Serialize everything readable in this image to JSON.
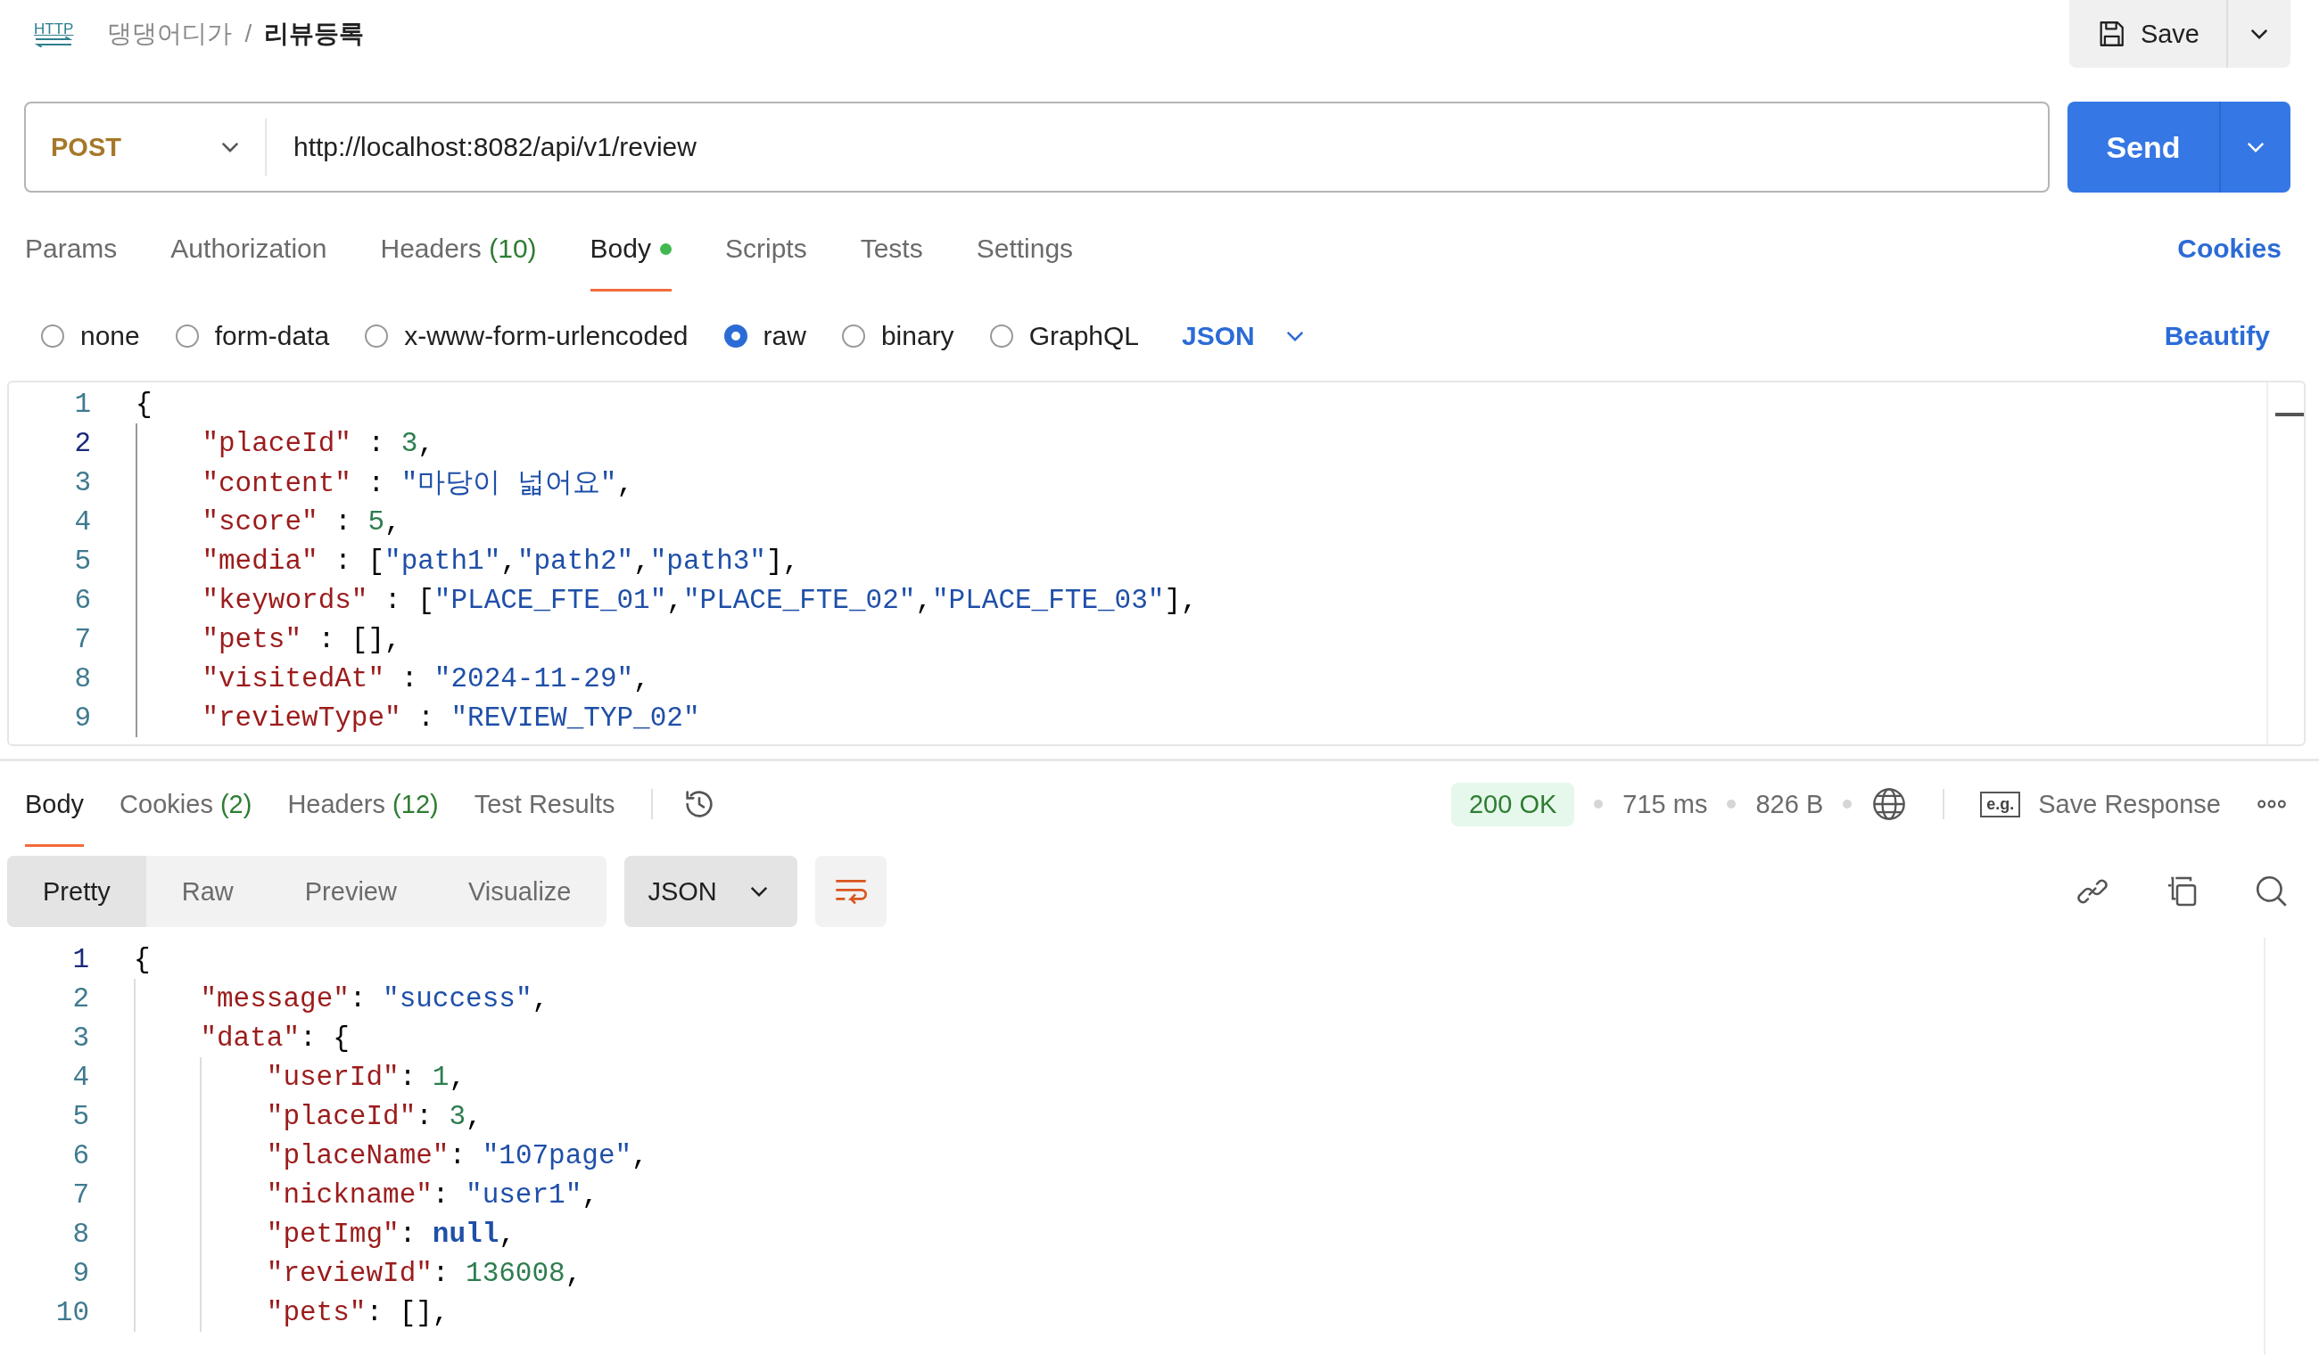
{
  "header": {
    "request_type": "HTTP",
    "breadcrumb_separator": "/",
    "breadcrumb": [
      {
        "label": "댕댕어디가",
        "current": false
      },
      {
        "label": "리뷰등록",
        "current": true
      }
    ],
    "save_label": "Save"
  },
  "request": {
    "method": "POST",
    "url": "http://localhost:8082/api/v1/review",
    "send_label": "Send"
  },
  "request_tabs": [
    {
      "label": "Params",
      "selected": false,
      "has_content": false
    },
    {
      "label": "Authorization",
      "selected": false,
      "has_content": false
    },
    {
      "label": "Headers",
      "count": "(10)",
      "selected": false,
      "has_content": false
    },
    {
      "label": "Body",
      "selected": true,
      "has_content": true
    },
    {
      "label": "Scripts",
      "selected": false,
      "has_content": false
    },
    {
      "label": "Tests",
      "selected": false,
      "has_content": false
    },
    {
      "label": "Settings",
      "selected": false,
      "has_content": false
    }
  ],
  "cookies_link": "Cookies",
  "body_types": [
    {
      "label": "none",
      "selected": false
    },
    {
      "label": "form-data",
      "selected": false
    },
    {
      "label": "x-www-form-urlencoded",
      "selected": false
    },
    {
      "label": "raw",
      "selected": true
    },
    {
      "label": "binary",
      "selected": false
    },
    {
      "label": "GraphQL",
      "selected": false
    }
  ],
  "body_format": "JSON",
  "beautify_label": "Beautify",
  "request_body": [
    {
      "number": "1",
      "current": false,
      "tokens": [
        {
          "kind": "punct",
          "text": "{"
        }
      ],
      "children": [
        {
          "number": "2",
          "current": true,
          "tokens": [
            {
              "kind": "key",
              "text": "\"placeId\""
            },
            {
              "kind": "punct",
              "text": " : "
            },
            {
              "kind": "num",
              "text": "3"
            },
            {
              "kind": "punct",
              "text": ","
            }
          ]
        },
        {
          "number": "3",
          "current": false,
          "tokens": [
            {
              "kind": "key",
              "text": "\"content\""
            },
            {
              "kind": "punct",
              "text": " : "
            },
            {
              "kind": "str",
              "text": "\"마당이 넓어요\""
            },
            {
              "kind": "punct",
              "text": ","
            }
          ]
        },
        {
          "number": "4",
          "current": false,
          "tokens": [
            {
              "kind": "key",
              "text": "\"score\""
            },
            {
              "kind": "punct",
              "text": " : "
            },
            {
              "kind": "num",
              "text": "5"
            },
            {
              "kind": "punct",
              "text": ","
            }
          ]
        },
        {
          "number": "5",
          "current": false,
          "tokens": [
            {
              "kind": "key",
              "text": "\"media\""
            },
            {
              "kind": "punct",
              "text": " : ["
            },
            {
              "kind": "str",
              "text": "\"path1\""
            },
            {
              "kind": "punct",
              "text": ","
            },
            {
              "kind": "str",
              "text": "\"path2\""
            },
            {
              "kind": "punct",
              "text": ","
            },
            {
              "kind": "str",
              "text": "\"path3\""
            },
            {
              "kind": "punct",
              "text": "],"
            }
          ]
        },
        {
          "number": "6",
          "current": false,
          "tokens": [
            {
              "kind": "key",
              "text": "\"keywords\""
            },
            {
              "kind": "punct",
              "text": " : ["
            },
            {
              "kind": "str",
              "text": "\"PLACE_FTE_01\""
            },
            {
              "kind": "punct",
              "text": ","
            },
            {
              "kind": "str",
              "text": "\"PLACE_FTE_02\""
            },
            {
              "kind": "punct",
              "text": ","
            },
            {
              "kind": "str",
              "text": "\"PLACE_FTE_03\""
            },
            {
              "kind": "punct",
              "text": "],"
            }
          ]
        },
        {
          "number": "7",
          "current": false,
          "tokens": [
            {
              "kind": "key",
              "text": "\"pets\""
            },
            {
              "kind": "punct",
              "text": " : [],"
            }
          ]
        },
        {
          "number": "8",
          "current": false,
          "tokens": [
            {
              "kind": "key",
              "text": "\"visitedAt\""
            },
            {
              "kind": "punct",
              "text": " : "
            },
            {
              "kind": "str",
              "text": "\"2024-11-29\""
            },
            {
              "kind": "punct",
              "text": ","
            }
          ]
        },
        {
          "number": "9",
          "current": false,
          "tokens": [
            {
              "kind": "key",
              "text": "\"reviewType\""
            },
            {
              "kind": "punct",
              "text": " : "
            },
            {
              "kind": "str",
              "text": "\"REVIEW_TYP_02\""
            }
          ]
        }
      ]
    }
  ],
  "response_tabs": [
    {
      "label": "Body",
      "selected": true
    },
    {
      "label": "Cookies",
      "count": "(2)",
      "selected": false
    },
    {
      "label": "Headers",
      "count": "(12)",
      "selected": false
    },
    {
      "label": "Test Results",
      "selected": false
    }
  ],
  "response_meta": {
    "status": "200 OK",
    "time": "715 ms",
    "size": "826 B",
    "example_label": "e.g.",
    "save_response": "Save Response"
  },
  "view_modes": [
    {
      "label": "Pretty",
      "selected": true
    },
    {
      "label": "Raw",
      "selected": false
    },
    {
      "label": "Preview",
      "selected": false
    },
    {
      "label": "Visualize",
      "selected": false
    }
  ],
  "response_format": "JSON",
  "response_body": [
    {
      "number": "1",
      "current": true,
      "tokens": [
        {
          "kind": "punct",
          "text": "{"
        }
      ],
      "children": [
        {
          "number": "2",
          "current": false,
          "tokens": [
            {
              "kind": "key",
              "text": "\"message\""
            },
            {
              "kind": "punct",
              "text": ": "
            },
            {
              "kind": "str",
              "text": "\"success\""
            },
            {
              "kind": "punct",
              "text": ","
            }
          ]
        },
        {
          "number": "3",
          "current": false,
          "tokens": [
            {
              "kind": "key",
              "text": "\"data\""
            },
            {
              "kind": "punct",
              "text": ": {"
            }
          ],
          "children": [
            {
              "number": "4",
              "current": false,
              "tokens": [
                {
                  "kind": "key",
                  "text": "\"userId\""
                },
                {
                  "kind": "punct",
                  "text": ": "
                },
                {
                  "kind": "num",
                  "text": "1"
                },
                {
                  "kind": "punct",
                  "text": ","
                }
              ]
            },
            {
              "number": "5",
              "current": false,
              "tokens": [
                {
                  "kind": "key",
                  "text": "\"placeId\""
                },
                {
                  "kind": "punct",
                  "text": ": "
                },
                {
                  "kind": "num",
                  "text": "3"
                },
                {
                  "kind": "punct",
                  "text": ","
                }
              ]
            },
            {
              "number": "6",
              "current": false,
              "tokens": [
                {
                  "kind": "key",
                  "text": "\"placeName\""
                },
                {
                  "kind": "punct",
                  "text": ": "
                },
                {
                  "kind": "str",
                  "text": "\"107page\""
                },
                {
                  "kind": "punct",
                  "text": ","
                }
              ]
            },
            {
              "number": "7",
              "current": false,
              "tokens": [
                {
                  "kind": "key",
                  "text": "\"nickname\""
                },
                {
                  "kind": "punct",
                  "text": ": "
                },
                {
                  "kind": "str",
                  "text": "\"user1\""
                },
                {
                  "kind": "punct",
                  "text": ","
                }
              ]
            },
            {
              "number": "8",
              "current": false,
              "tokens": [
                {
                  "kind": "key",
                  "text": "\"petImg\""
                },
                {
                  "kind": "punct",
                  "text": ": "
                },
                {
                  "kind": "kw",
                  "text": "null"
                },
                {
                  "kind": "punct",
                  "text": ","
                }
              ]
            },
            {
              "number": "9",
              "current": false,
              "tokens": [
                {
                  "kind": "key",
                  "text": "\"reviewId\""
                },
                {
                  "kind": "punct",
                  "text": ": "
                },
                {
                  "kind": "num",
                  "text": "136008"
                },
                {
                  "kind": "punct",
                  "text": ","
                }
              ]
            },
            {
              "number": "10",
              "current": false,
              "tokens": [
                {
                  "kind": "key",
                  "text": "\"pets\""
                },
                {
                  "kind": "punct",
                  "text": ": [],"
                }
              ]
            }
          ]
        }
      ]
    }
  ]
}
